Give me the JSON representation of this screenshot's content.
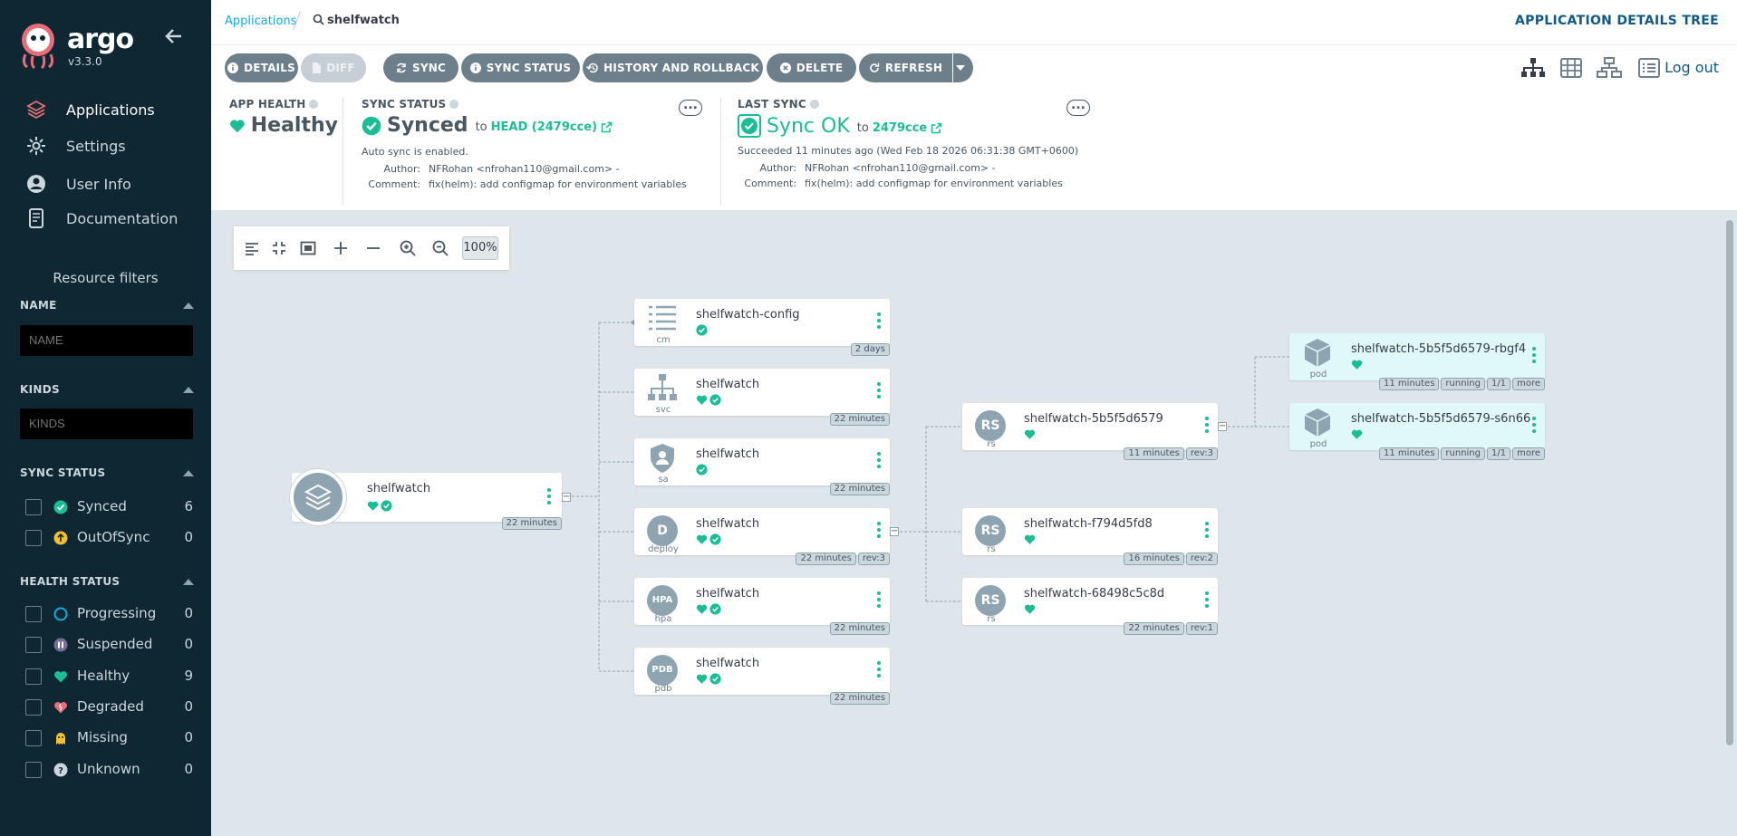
{
  "app": {
    "brand": "argo",
    "version": "v3.3.0"
  },
  "nav": {
    "items": [
      {
        "label": "Applications",
        "icon": "layers-icon"
      },
      {
        "label": "Settings",
        "icon": "gear-icon"
      },
      {
        "label": "User Info",
        "icon": "user-icon"
      },
      {
        "label": "Documentation",
        "icon": "book-icon"
      }
    ]
  },
  "filters": {
    "title": "Resource filters",
    "name": {
      "label": "NAME",
      "placeholder": "NAME"
    },
    "kinds": {
      "label": "KINDS",
      "placeholder": "KINDS"
    },
    "sync": {
      "label": "SYNC STATUS",
      "items": [
        {
          "label": "Synced",
          "count": "6",
          "color": "#18be94"
        },
        {
          "label": "OutOfSync",
          "count": "0",
          "color": "#f4c030"
        }
      ]
    },
    "health": {
      "label": "HEALTH STATUS",
      "items": [
        {
          "label": "Progressing",
          "count": "0",
          "color": "#0dadea"
        },
        {
          "label": "Suspended",
          "count": "0",
          "color": "#766f94"
        },
        {
          "label": "Healthy",
          "count": "9",
          "color": "#18be94"
        },
        {
          "label": "Degraded",
          "count": "0",
          "color": "#e96d76"
        },
        {
          "label": "Missing",
          "count": "0",
          "color": "#f4c030"
        },
        {
          "label": "Unknown",
          "count": "0",
          "color": "#ccd6dd"
        }
      ]
    }
  },
  "breadcrumb": {
    "root": "Applications",
    "current": "shelfwatch"
  },
  "page_title": "APPLICATION DETAILS TREE",
  "toolbar": {
    "details": "DETAILS",
    "diff": "DIFF",
    "sync": "SYNC",
    "sync_status": "SYNC STATUS",
    "history": "HISTORY AND ROLLBACK",
    "delete": "DELETE",
    "refresh": "REFRESH",
    "logout": "Log out"
  },
  "status": {
    "health": {
      "label": "APP HEALTH",
      "value": "Healthy"
    },
    "sync": {
      "label": "SYNC STATUS",
      "value": "Synced",
      "to": "to",
      "rev": "HEAD (2479cce)",
      "auto": "Auto sync is enabled.",
      "author_label": "Author:",
      "author": "NFRohan <nfrohan110@gmail.com> -",
      "comment_label": "Comment:",
      "comment": "fix(helm): add configmap for environment variables"
    },
    "last": {
      "label": "LAST SYNC",
      "value": "Sync OK",
      "to": "to",
      "rev": "2479cce",
      "when": "Succeeded 11 minutes ago (Wed Feb 18 2026 06:31:38 GMT+0600)",
      "author_label": "Author:",
      "author": "NFRohan <nfrohan110@gmail.com> -",
      "comment_label": "Comment:",
      "comment": "fix(helm): add configmap for environment variables"
    }
  },
  "canvas_tools": {
    "zoom": "100%"
  },
  "tree": {
    "app": {
      "name": "shelfwatch",
      "age": "22 minutes"
    },
    "resources": [
      {
        "name": "shelfwatch-config",
        "kind": "cm",
        "tags": [
          "2 days"
        ]
      },
      {
        "name": "shelfwatch",
        "kind": "svc",
        "tags": [
          "22 minutes"
        ]
      },
      {
        "name": "shelfwatch",
        "kind": "sa",
        "tags": [
          "22 minutes"
        ]
      },
      {
        "name": "shelfwatch",
        "kind": "deploy",
        "badge": "D",
        "tags": [
          "22 minutes",
          "rev:3"
        ]
      },
      {
        "name": "shelfwatch",
        "kind": "hpa",
        "badge": "HPA",
        "tags": [
          "22 minutes"
        ]
      },
      {
        "name": "shelfwatch",
        "kind": "pdb",
        "badge": "PDB",
        "tags": [
          "22 minutes"
        ]
      }
    ],
    "replicasets": [
      {
        "name": "shelfwatch-5b5f5d6579",
        "kind": "rs",
        "badge": "RS",
        "tags": [
          "11 minutes",
          "rev:3"
        ]
      },
      {
        "name": "shelfwatch-f794d5fd8",
        "kind": "rs",
        "badge": "RS",
        "tags": [
          "16 minutes",
          "rev:2"
        ]
      },
      {
        "name": "shelfwatch-68498c5c8d",
        "kind": "rs",
        "badge": "RS",
        "tags": [
          "22 minutes",
          "rev:1"
        ]
      }
    ],
    "pods": [
      {
        "name": "shelfwatch-5b5f5d6579-rbgf4",
        "kind": "pod",
        "tags": [
          "11 minutes",
          "running",
          "1/1",
          "more"
        ]
      },
      {
        "name": "shelfwatch-5b5f5d6579-s6n66",
        "kind": "pod",
        "tags": [
          "11 minutes",
          "running",
          "1/1",
          "more"
        ]
      }
    ]
  },
  "colors": {
    "sidebar": "#0e2733",
    "accent": "#18be94",
    "link": "#0dadea",
    "grey": "#6d7f8b"
  }
}
